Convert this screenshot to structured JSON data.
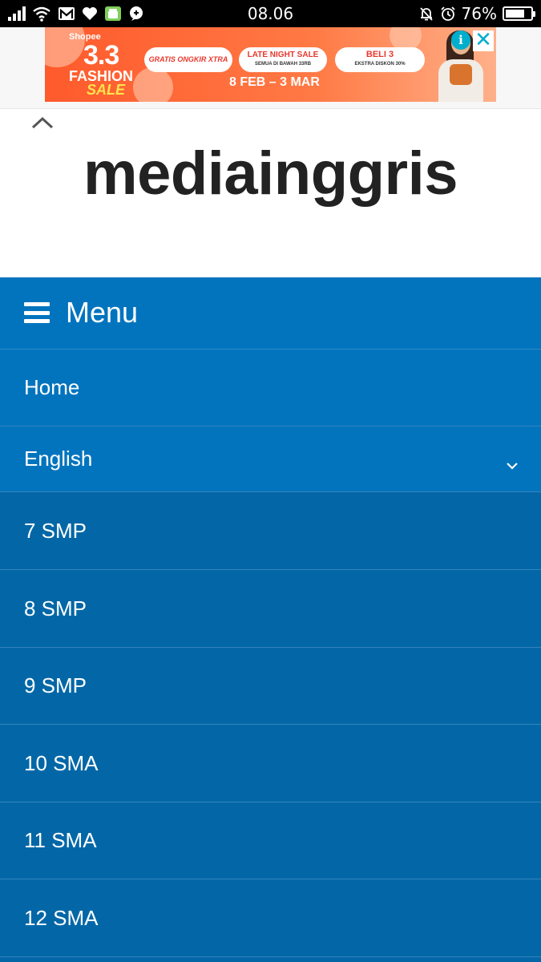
{
  "status_bar": {
    "time": "08.06",
    "battery": "76%",
    "battery_level": 0.76
  },
  "ad": {
    "brand": "Shopee",
    "headline": "3.3",
    "line_fashion": "FASHION",
    "line_sale": "SALE",
    "pills": [
      {
        "title": "GRATIS ONGKIR XTRA",
        "subtitle": ""
      },
      {
        "title": "LATE NIGHT SALE",
        "subtitle": "SEMUA DI BAWAH 33RB"
      },
      {
        "title": "BELI 3",
        "subtitle": "EKSTRA DISKON 30%"
      }
    ],
    "date_range": "8 FEB – 3 MAR",
    "info_glyph": "i",
    "close_glyph": "✕"
  },
  "header": {
    "site_title": "mediainggris"
  },
  "menu": {
    "label": "Menu",
    "items": [
      {
        "label": "Home"
      },
      {
        "label": "English"
      }
    ],
    "sub_items": [
      {
        "label": "7 SMP"
      },
      {
        "label": "8 SMP"
      },
      {
        "label": "9 SMP"
      },
      {
        "label": "10 SMA"
      },
      {
        "label": "11 SMA"
      },
      {
        "label": "12 SMA"
      }
    ]
  },
  "colors": {
    "menu_bg": "#0274be",
    "submenu_bg": "#0367a7",
    "ad_accent": "#ff5a2c"
  }
}
